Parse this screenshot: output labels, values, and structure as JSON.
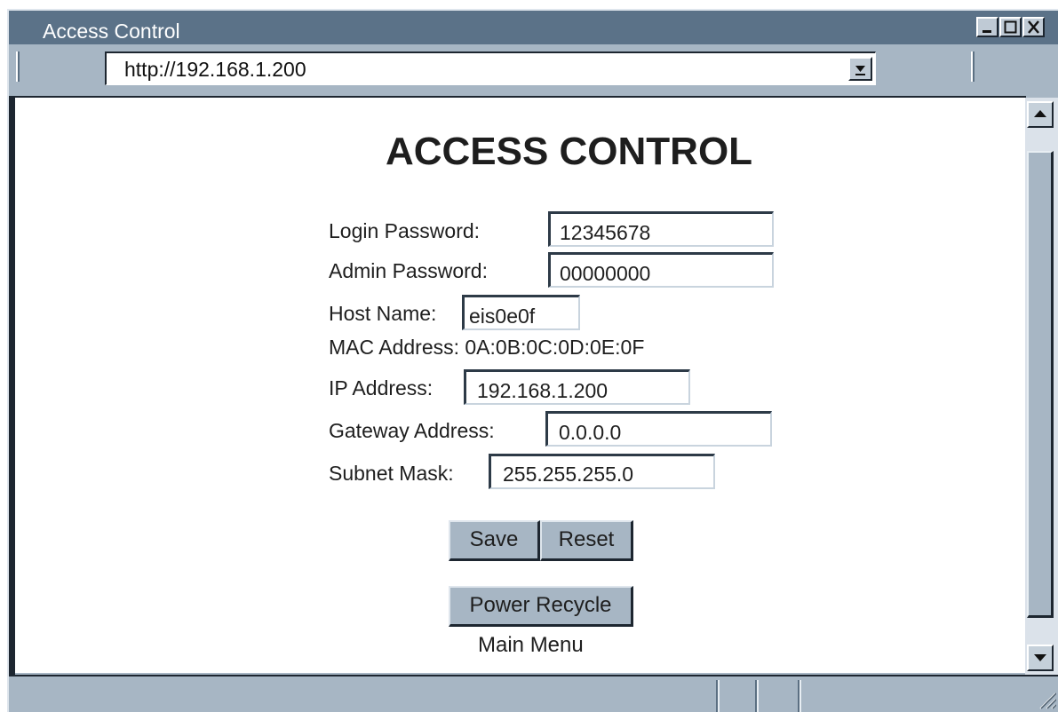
{
  "window": {
    "title": "Access Control",
    "controls": {
      "minimize": "minimize",
      "maximize": "maximize",
      "close": "close"
    }
  },
  "address_bar": {
    "url": "http://192.168.1.200"
  },
  "page": {
    "heading": "ACCESS CONTROL",
    "fields": {
      "login_password": {
        "label": "Login Password:",
        "value": "12345678"
      },
      "admin_password": {
        "label": "Admin Password:",
        "value": "00000000"
      },
      "host_name": {
        "label": "Host Name:",
        "value": "eis0e0f"
      },
      "mac_address": {
        "text": "MAC Address: 0A:0B:0C:0D:0E:0F"
      },
      "ip_address": {
        "label": "IP Address:",
        "value": "192.168.1.200"
      },
      "gateway_address": {
        "label": "Gateway Address:",
        "value": "0.0.0.0"
      },
      "subnet_mask": {
        "label": "Subnet Mask:",
        "value": "255.255.255.0"
      }
    },
    "buttons": {
      "save": "Save",
      "reset": "Reset",
      "power_recycle": "Power Recycle"
    },
    "main_menu_link": "Main Menu"
  }
}
